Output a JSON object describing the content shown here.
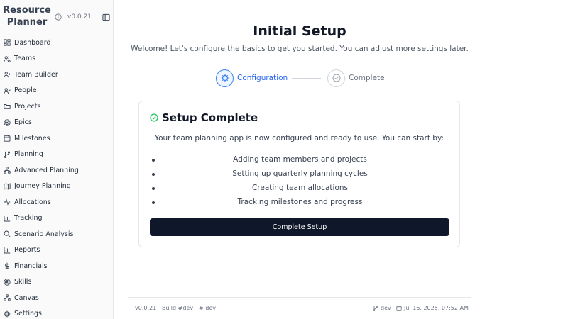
{
  "app": {
    "title_line1": "Resource",
    "title_line2": "Planner",
    "version": "v0.0.21"
  },
  "sidebar": {
    "items": [
      {
        "label": "Dashboard",
        "icon": "dashboard-icon"
      },
      {
        "label": "Teams",
        "icon": "users-icon"
      },
      {
        "label": "Team Builder",
        "icon": "user-plus-icon"
      },
      {
        "label": "People",
        "icon": "user-check-icon"
      },
      {
        "label": "Projects",
        "icon": "folder-icon"
      },
      {
        "label": "Epics",
        "icon": "target-icon"
      },
      {
        "label": "Milestones",
        "icon": "calendar-icon"
      },
      {
        "label": "Planning",
        "icon": "git-branch-icon"
      },
      {
        "label": "Advanced Planning",
        "icon": "network-icon"
      },
      {
        "label": "Journey Planning",
        "icon": "map-icon"
      },
      {
        "label": "Allocations",
        "icon": "activity-icon"
      },
      {
        "label": "Tracking",
        "icon": "bar-chart-icon"
      },
      {
        "label": "Scenario Analysis",
        "icon": "search-icon"
      },
      {
        "label": "Reports",
        "icon": "bar-chart-icon"
      },
      {
        "label": "Financials",
        "icon": "dollar-icon"
      },
      {
        "label": "Skills",
        "icon": "target-icon"
      },
      {
        "label": "Canvas",
        "icon": "network-icon"
      },
      {
        "label": "Settings",
        "icon": "gear-icon"
      }
    ]
  },
  "main": {
    "title": "Initial Setup",
    "subtitle": "Welcome! Let's configure the basics to get you started. You can adjust more settings later.",
    "steps": [
      {
        "label": "Configuration",
        "state": "active"
      },
      {
        "label": "Complete",
        "state": "pending"
      }
    ],
    "card": {
      "title": "Setup Complete",
      "description": "Your team planning app is now configured and ready to use. You can start by:",
      "bullets": [
        "Adding team members and projects",
        "Setting up quarterly planning cycles",
        "Creating team allocations",
        "Tracking milestones and progress"
      ],
      "button_label": "Complete Setup"
    }
  },
  "footer": {
    "version": "v0.0.21",
    "build": "Build #dev",
    "hash": "# dev",
    "branch": "dev",
    "date": "Jul 16, 2025, 07:52 AM"
  },
  "colors": {
    "accent": "#3b82f6",
    "success": "#22c55e",
    "primary_button": "#0f172a"
  }
}
